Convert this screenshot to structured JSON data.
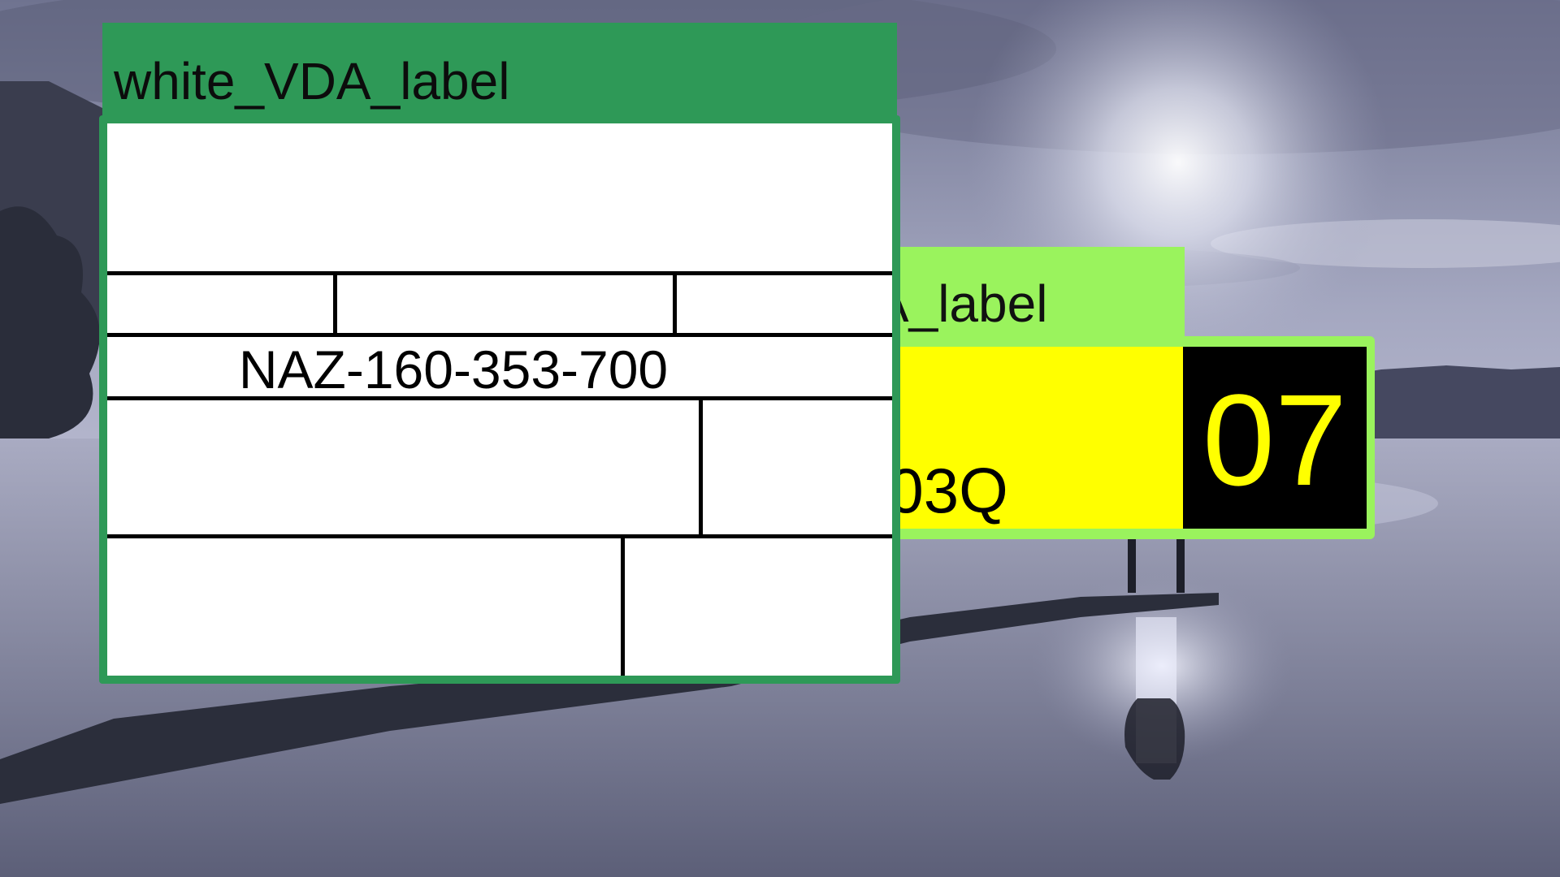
{
  "background": {
    "description_colors": {
      "sky": "#9a9db6",
      "water": "#8d90aa",
      "dark": "#2a2d3a",
      "glow": "#eef0ff"
    }
  },
  "back_label": {
    "title": "white_VDA_label",
    "code": "503Q",
    "number": "07",
    "colors": {
      "frame": "#9af35d",
      "panel": "#ffff00",
      "number_bg": "#000000",
      "number_fg": "#ffff00"
    }
  },
  "front_label": {
    "title": "white_VDA_label",
    "part_number": "NAZ-160-353-700",
    "colors": {
      "frame": "#2e9957",
      "card": "#ffffff",
      "lines": "#000000"
    }
  }
}
